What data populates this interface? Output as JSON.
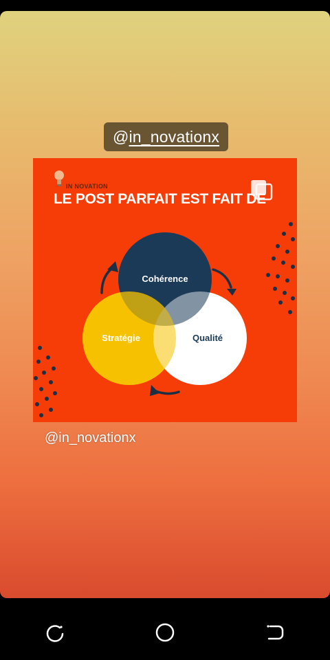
{
  "story": {
    "mention_sticker": {
      "at": "@",
      "handle": "in_novationx"
    },
    "caption": "@in_novationx"
  },
  "post": {
    "brand": "IN NOVATION",
    "headline": "LE POST PARFAIT EST FAIT DE",
    "circles": {
      "top": "Cohérence",
      "left": "Stratégie",
      "right": "Qualité"
    }
  },
  "navbar": {
    "icons": [
      "recent-apps-icon",
      "home-icon",
      "back-icon"
    ]
  },
  "colors": {
    "post_background": "#f63c07",
    "circle_top": "#1b3a57",
    "circle_left": "#f6c200",
    "circle_right": "#ffffff"
  }
}
